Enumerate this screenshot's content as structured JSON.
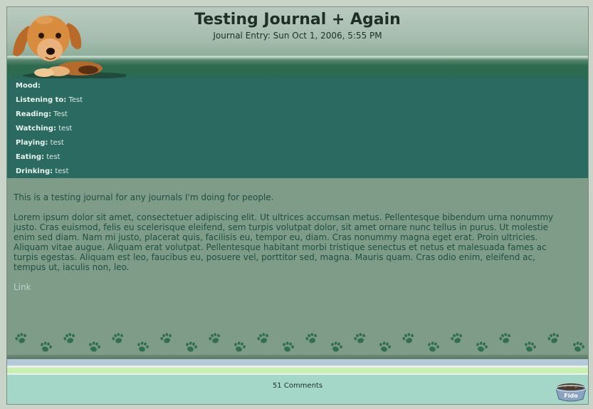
{
  "journal": {
    "title": "Testing Journal + Again",
    "entry_date": "Journal Entry: Sun Oct 1, 2006, 5:55 PM"
  },
  "info": {
    "items": [
      {
        "label": "Mood:",
        "value": ""
      },
      {
        "label": "Listening to:",
        "value": "Test"
      },
      {
        "label": "Reading:",
        "value": "Test"
      },
      {
        "label": "Watching:",
        "value": "test"
      },
      {
        "label": "Playing:",
        "value": "test"
      },
      {
        "label": "Eating:",
        "value": "test"
      },
      {
        "label": "Drinking:",
        "value": "test"
      }
    ]
  },
  "content": {
    "intro": "This is a testing journal for any journals I'm doing for people.",
    "lorem_lines": [
      "Lorem ipsum dolor sit amet, consectetuer adipiscing elit. Ut ultrices accumsan metus. Pellentesque bibendum urna nonummy",
      "justo. Cras euismod, felis eu scelerisque eleifend, sem turpis volutpat dolor, sit amet ornare nunc tellus in purus. Ut molestie",
      "enim sed diam. Nam mi justo, placerat quis, facilisis eu, tempor eu, diam. Cras nonummy magna eget erat. Proin ultricies.",
      "Aliquam vitae augue. Aliquam erat volutpat. Pellentesque habitant morbi tristique senectus et netus et malesuada fames ac",
      "turpis egestas. Aliquam est leo, faucibus eu, posuere vel, porttitor sed, magna. Mauris quam. Cras odio enim, eleifend ac,",
      "tempus ut, iaculis non, leo."
    ],
    "link_label": "Link"
  },
  "footer": {
    "comments_label": "51 Comments",
    "bowl_text": "Fido"
  },
  "colors": {
    "info_bg": "#2b6a60",
    "body_bg": "#7e9c87",
    "footer_bg": "#a5d7c8",
    "paw": "#2f6e4e"
  },
  "icons": {
    "header_art": "puppy-illustration",
    "paw": "paw-print-icon",
    "bowl": "dog-bowl-icon"
  }
}
